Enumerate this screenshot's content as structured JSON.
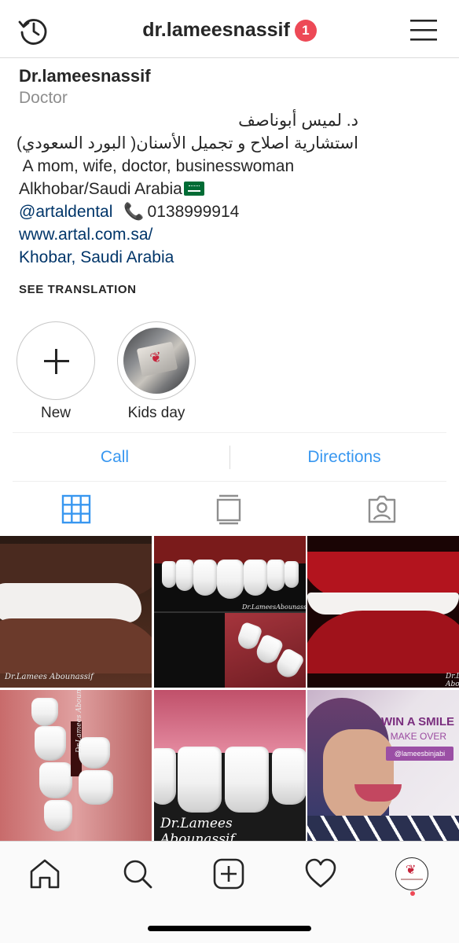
{
  "header": {
    "username": "dr.lameesnassif",
    "notification_count": "1"
  },
  "profile": {
    "name": "Dr.lameesnassif",
    "category": "Doctor",
    "bio_lines": [
      "د. لميس أبوناصف",
      "استشارية اصلاح و تجميل الأسنان( البورد السعودي)",
      " A mom, wife, doctor, businesswoman",
      "Alkhobar/Saudi Arabia"
    ],
    "mention": "@artaldental",
    "phone": "0138999914",
    "website": "www.artal.com.sa/",
    "location": "Khobar, Saudi Arabia",
    "see_translation": "SEE TRANSLATION"
  },
  "highlights": [
    {
      "label": "New"
    },
    {
      "label": "Kids day"
    }
  ],
  "actions": {
    "call": "Call",
    "directions": "Directions"
  },
  "posts": {
    "captions": [
      "Dr.Lamees Abounassif",
      "Dr.LameesAbounassif",
      "Dr.Lamees Abounassif",
      "Dr.Lamees Abounassif",
      "WIN A SMILE",
      "MAKE OVER",
      "@lameesbinjabi"
    ]
  },
  "colors": {
    "accent": "#3897f0",
    "link": "#003569",
    "badge": "#ed4956",
    "text": "#262626",
    "muted": "#8e8e8e"
  },
  "icons": [
    "history-icon",
    "menu-icon",
    "grid-icon",
    "feed-icon",
    "tagged-icon",
    "home-icon",
    "search-icon",
    "add-post-icon",
    "heart-icon",
    "profile-avatar-icon",
    "phone-icon",
    "saudi-flag-icon"
  ]
}
